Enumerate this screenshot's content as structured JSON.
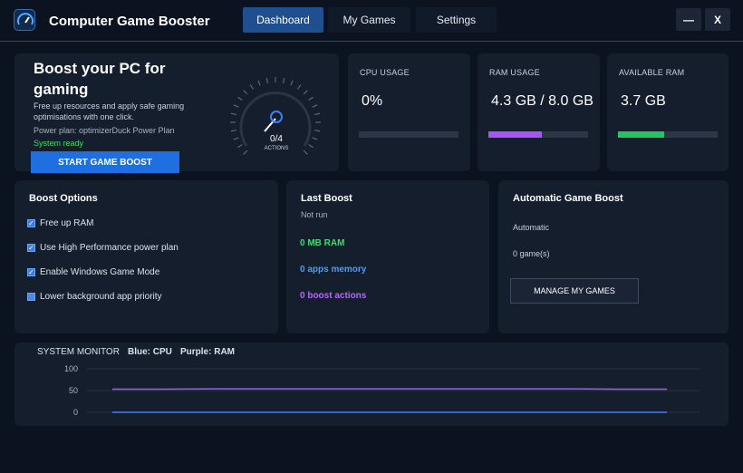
{
  "header": {
    "app_title": "Computer Game Booster",
    "tabs": [
      {
        "label": "Dashboard",
        "active": true
      },
      {
        "label": "My Games",
        "active": false
      },
      {
        "label": "Settings",
        "active": false
      }
    ],
    "minimize_label": "—",
    "close_label": "X"
  },
  "hero": {
    "title": "Boost your PC for gaming",
    "description": "Free up resources and apply safe gaming optimisations with one click.",
    "power_plan": "Power plan: optimizerDuck Power Plan",
    "status": "System ready",
    "button_label": "START GAME BOOST",
    "gauge_value": "0/4",
    "gauge_label": "ACTIONS"
  },
  "stats": [
    {
      "label": "CPU USAGE",
      "value": "0%",
      "fill": 0,
      "color": "#3b82f6"
    },
    {
      "label": "RAM USAGE",
      "value": "4.3 GB / 8.0 GB",
      "fill": 0.5375,
      "color": "#a855f7"
    },
    {
      "label": "AVAILABLE RAM",
      "value": "3.7 GB",
      "fill": 0.4625,
      "color": "#22c55e"
    }
  ],
  "boost_options": {
    "title": "Boost Options",
    "items": [
      {
        "label": "Free up RAM",
        "checked": true
      },
      {
        "label": "Use High Performance power plan",
        "checked": true
      },
      {
        "label": "Enable Windows Game Mode",
        "checked": true
      },
      {
        "label": "Lower background app priority",
        "checked": false
      }
    ]
  },
  "last_boost": {
    "title": "Last Boost",
    "status": "Not run",
    "ram": "0 MB RAM",
    "apps_memory": "0 apps memory",
    "boost_actions": "0 boost actions"
  },
  "auto_boost": {
    "title": "Automatic Game Boost",
    "mode": "Automatic",
    "games": "0 game(s)",
    "button_label": "MANAGE MY GAMES"
  },
  "monitor": {
    "title": "SYSTEM MONITOR",
    "legend_cpu": "Blue: CPU",
    "legend_ram": "Purple: RAM"
  },
  "chart_data": {
    "type": "line",
    "title": "",
    "xlabel": "",
    "ylabel": "",
    "ylim": [
      0,
      100
    ],
    "yticks": [
      "100",
      "50",
      "0"
    ],
    "grid": true,
    "series": [
      {
        "name": "CPU",
        "color": "#3b82f6",
        "values": [
          0,
          0,
          0,
          0,
          0,
          0,
          0,
          0,
          0,
          0,
          0,
          0
        ]
      },
      {
        "name": "RAM",
        "color": "#a855f7",
        "values": [
          53,
          53,
          54,
          54,
          54,
          54,
          54,
          54,
          54,
          54,
          53,
          53
        ]
      }
    ]
  }
}
